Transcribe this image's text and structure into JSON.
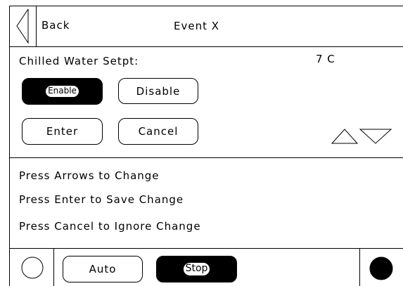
{
  "header": {
    "back_label": "Back",
    "title": "Event X"
  },
  "setpoint": {
    "label": "Chilled Water Setpt:",
    "value": "7 C"
  },
  "buttons": {
    "enable": "Enable",
    "disable": "Disable",
    "enter": "Enter",
    "cancel": "Cancel"
  },
  "instructions": [
    "Press Arrows to Change",
    "Press Enter to Save Change",
    "Press Cancel to Ignore Change"
  ],
  "footer": {
    "auto": "Auto",
    "stop": "Stop"
  },
  "icons": {
    "back": "back-arrow-icon",
    "up": "up-triangle-icon",
    "down": "down-triangle-icon",
    "status_off": "status-circle-empty-icon",
    "status_on": "status-circle-filled-icon"
  },
  "colors": {
    "foreground": "#000000",
    "background": "#ffffff"
  }
}
